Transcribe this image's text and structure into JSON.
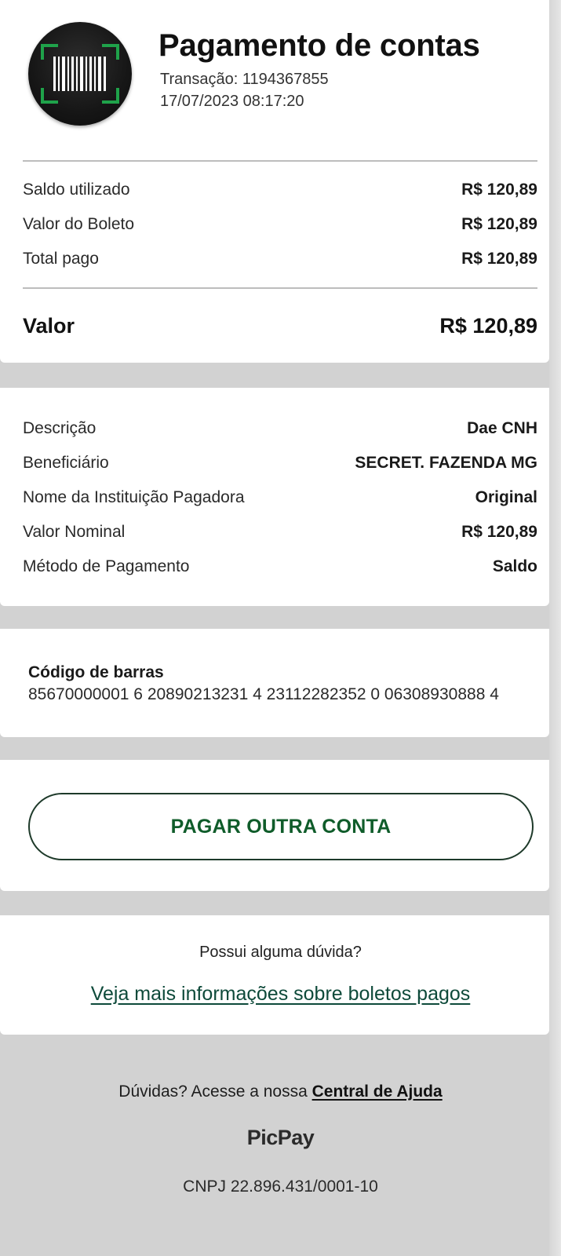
{
  "header": {
    "title": "Pagamento de contas",
    "transaction": "Transação: 1194367855",
    "datetime": "17/07/2023 08:17:20",
    "icon": "barcode-scan-icon"
  },
  "summary": {
    "rows": [
      {
        "label": "Saldo utilizado",
        "value": "R$ 120,89"
      },
      {
        "label": "Valor do Boleto",
        "value": "R$ 120,89"
      },
      {
        "label": "Total pago",
        "value": "R$ 120,89"
      }
    ],
    "total": {
      "label": "Valor",
      "value": "R$ 120,89"
    }
  },
  "details": {
    "rows": [
      {
        "label": "Descrição",
        "value": "Dae CNH"
      },
      {
        "label": "Beneficiário",
        "value": "SECRET. FAZENDA MG"
      },
      {
        "label": "Nome da Instituição Pagadora",
        "value": "Original"
      },
      {
        "label": "Valor Nominal",
        "value": "R$ 120,89"
      },
      {
        "label": "Método de Pagamento",
        "value": "Saldo"
      }
    ]
  },
  "barcode": {
    "label": "Código de barras",
    "value": "85670000001 6 20890213231 4 23112282352 0 06308930888 4"
  },
  "action": {
    "button_label": "PAGAR OUTRA CONTA"
  },
  "help": {
    "question": "Possui alguma dúvida?",
    "link": "Veja mais informações sobre boletos pagos"
  },
  "footer": {
    "help_prefix": "Dúvidas? Acesse a nossa ",
    "help_link": "Central de Ajuda",
    "brand": "PicPay",
    "cnpj": "CNPJ 22.896.431/0001-10"
  },
  "colors": {
    "accent_green": "#0f5c2a",
    "scan_frame_green": "#1fa24a",
    "background": "#d2d2d2"
  }
}
